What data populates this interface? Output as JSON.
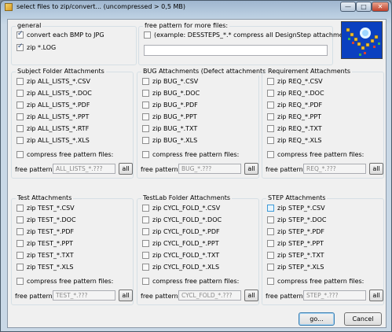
{
  "window": {
    "title": "select files to zip/convert... (uncompressed > 0,5 MB)",
    "min_glyph": "—",
    "max_glyph": "□",
    "close_glyph": "✕"
  },
  "general": {
    "title": "general",
    "items": [
      {
        "label": "convert each BMP to JPG",
        "checked": true
      },
      {
        "label": "zip *.LOG",
        "checked": true
      }
    ]
  },
  "free_pattern_more": {
    "title": "free pattern for more files:",
    "checkbox_label": "(example: DESSTEPS_*.* compress all DesignStep attachments)",
    "checked": false,
    "value": ""
  },
  "groups": [
    {
      "id": "subject",
      "title": "Subject Folder Attachments",
      "items": [
        "zip ALL_LISTS_*.CSV",
        "zip ALL_LISTS_*.DOC",
        "zip ALL_LISTS_*.PDF",
        "zip ALL_LISTS_*.PPT",
        "zip ALL_LISTS_*.RTF",
        "zip ALL_LISTS_*.XLS"
      ],
      "compress_label": "compress free pattern files:",
      "pattern_label": "free pattern:",
      "pattern_value": "ALL_LISTS_*.???",
      "all_label": "all"
    },
    {
      "id": "bug",
      "title": "BUG Attachments (Defect attachments)",
      "items": [
        "zip BUG_*.CSV",
        "zip BUG_*.DOC",
        "zip BUG_*.PDF",
        "zip BUG_*.PPT",
        "zip BUG_*.TXT",
        "zip BUG_*.XLS"
      ],
      "compress_label": "compress free pattern files:",
      "pattern_label": "free pattern:",
      "pattern_value": "BUG_*.???",
      "all_label": "all"
    },
    {
      "id": "requirement",
      "title": "Requirement Attachments",
      "items": [
        "zip REQ_*.CSV",
        "zip REQ_*.DOC",
        "zip REQ_*.PDF",
        "zip REQ_*.PPT",
        "zip REQ_*.TXT",
        "zip REQ_*.XLS"
      ],
      "compress_label": "compress free pattern files:",
      "pattern_label": "free pattern:",
      "pattern_value": "REQ_*.???",
      "all_label": "all"
    },
    {
      "id": "test",
      "title": "Test Attachments",
      "items": [
        "zip TEST_*.CSV",
        "zip TEST_*.DOC",
        "zip TEST_*.PDF",
        "zip TEST_*.PPT",
        "zip TEST_*.TXT",
        "zip TEST_*.XLS"
      ],
      "compress_label": "compress free pattern files:",
      "pattern_label": "free pattern:",
      "pattern_value": "TEST_*.???",
      "all_label": "all"
    },
    {
      "id": "testlab",
      "title": "TestLab Folder Attachments",
      "items": [
        "zip CYCL_FOLD_*.CSV",
        "zip CYCL_FOLD_*.DOC",
        "zip CYCL_FOLD_*.PDF",
        "zip CYCL_FOLD_*.PPT",
        "zip CYCL_FOLD_*.TXT",
        "zip CYCL_FOLD_*.XLS"
      ],
      "compress_label": "compress free pattern files:",
      "pattern_label": "free pattern:",
      "pattern_value": "CYCL_FOLD_*.???",
      "all_label": "all"
    },
    {
      "id": "step",
      "title": "STEP Attachments",
      "items": [
        "zip STEP_*.CSV",
        "zip STEP_*.DOC",
        "zip STEP_*.PDF",
        "zip STEP_*.PPT",
        "zip STEP_*.TXT",
        "zip STEP_*.XLS"
      ],
      "compress_label": "compress free pattern files:",
      "pattern_label": "free pattern:",
      "pattern_value": "STEP_*.???",
      "all_label": "all"
    }
  ],
  "buttons": {
    "go": "go...",
    "cancel": "Cancel"
  },
  "colors": {
    "accent": "#3c9ad8",
    "logo_background": "#0e4bd0"
  }
}
